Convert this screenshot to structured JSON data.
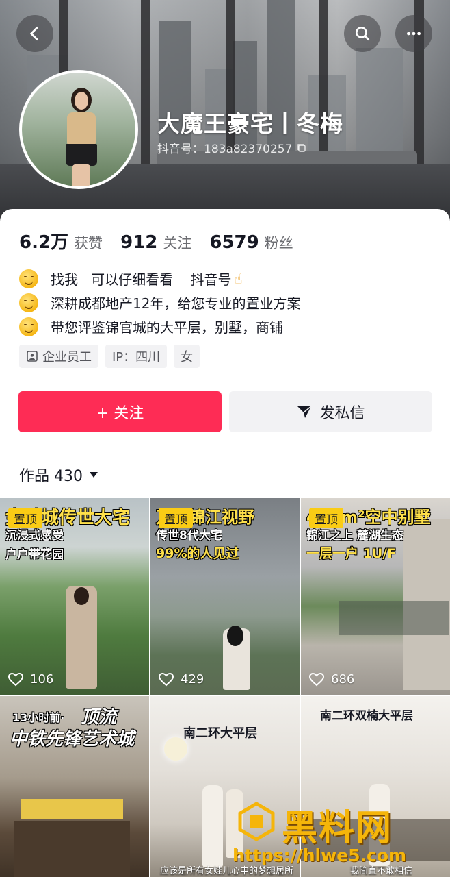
{
  "header": {
    "nickname": "大魔王豪宅丨冬梅",
    "douyin_id": "抖音号：183a82370257"
  },
  "stats": [
    {
      "value": "6.2万",
      "label": "获赞"
    },
    {
      "value": "912",
      "label": "关注"
    },
    {
      "value": "6579",
      "label": "粉丝"
    }
  ],
  "bio": [
    {
      "text": "找我   可以仔细看看    抖音号"
    },
    {
      "text": "深耕成都地产12年，给您专业的置业方案"
    },
    {
      "text": "带您评鉴锦官城的大平层，别墅，商铺"
    }
  ],
  "tags": [
    "企业员工",
    "IP：四川",
    "女"
  ],
  "actions": {
    "follow_label": "+ 关注",
    "message_label": "发私信"
  },
  "works_tab": {
    "label": "作品 430"
  },
  "videos": [
    {
      "pinned": "置顶",
      "cap1": "金融城传世大宅",
      "cap2": "沉浸式感受",
      "cap3": "户户带花园",
      "likes": "106"
    },
    {
      "pinned": "置顶",
      "cap1": "万光锦江视野",
      "cap2": "传世8代大宅",
      "cap3": "99%的人见过",
      "likes": "429"
    },
    {
      "pinned": "置顶",
      "cap1": "460m²空中别墅",
      "cap2": "锦江之上 麓湖生态",
      "cap3": "一层一户 1U/F",
      "likes": "686"
    },
    {
      "cap0": "13小时前·",
      "cap1": "顶流",
      "cap2": "中铁先锋艺术城",
      "likes": ""
    },
    {
      "cap1": "南二环大平层",
      "bottom": "应该是所有女娃儿心中的梦想居所"
    },
    {
      "cap1": "南二环双楠大平层",
      "bottom": "我简直不敢相信"
    }
  ],
  "watermark": {
    "brand": "黑料网",
    "url": "https://hlwe5.com"
  },
  "colors": {
    "accent": "#fe2c55",
    "pin": "#facc15",
    "watermark": "#f5b50a"
  }
}
